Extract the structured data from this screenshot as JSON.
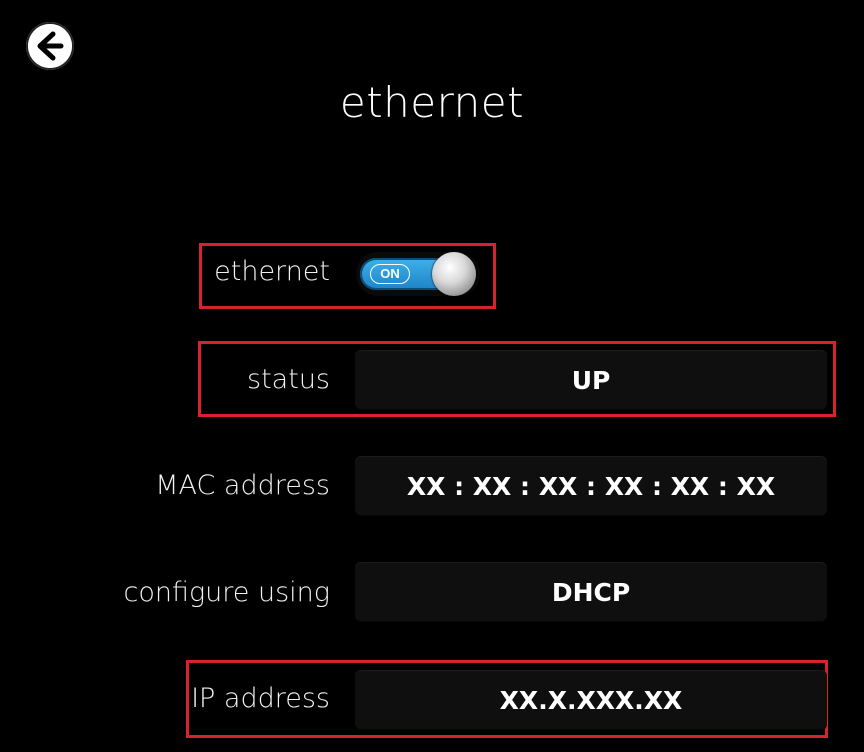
{
  "header": {
    "title": "ethernet",
    "back_icon": "back-arrow-icon"
  },
  "settings": {
    "ethernet": {
      "label": "ethernet",
      "toggle_text": "ON",
      "enabled": true
    },
    "status": {
      "label": "status",
      "value": "UP"
    },
    "mac": {
      "label": "MAC address",
      "value": "XX : XX : XX : XX : XX : XX"
    },
    "configure": {
      "label": "configure using",
      "value": "DHCP"
    },
    "ip": {
      "label": "IP address",
      "value": "XX.X.XXX.XX"
    }
  },
  "colors": {
    "background": "#000000",
    "highlight": "#d8232f",
    "toggle_on": "#2a9ad9"
  }
}
